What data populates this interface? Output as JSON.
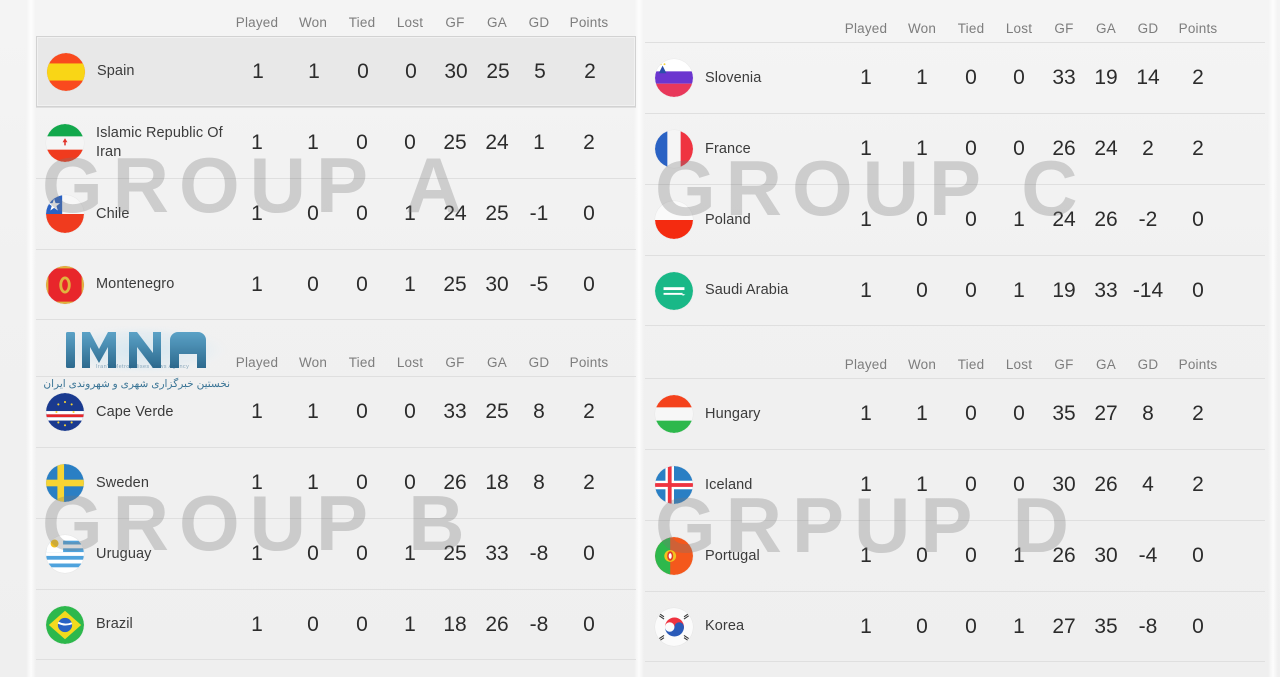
{
  "columns": [
    "Played",
    "Won",
    "Tied",
    "Lost",
    "GF",
    "GA",
    "GD",
    "Points"
  ],
  "watermarks": {
    "group_a": "GROUP A",
    "group_b": "GROUP B",
    "group_c": "GROUP C",
    "group_d": "GRPUP D"
  },
  "logo": {
    "name": "IMNA",
    "tagline_en": "Iran's Metropolises News Agency",
    "tagline_fa": "نخستین خبرگزاری شهری و شهروندی ایران"
  },
  "groups": [
    {
      "id": "group-a",
      "watermark": "GROUP A",
      "rows": [
        {
          "team": "Spain",
          "flag": "spain-flag",
          "highlight": true,
          "played": "1",
          "won": "1",
          "tied": "0",
          "lost": "0",
          "gf": "30",
          "ga": "25",
          "gd": "5",
          "points": "2"
        },
        {
          "team": "Islamic Republic Of Iran",
          "flag": "iran-flag",
          "highlight": false,
          "played": "1",
          "won": "1",
          "tied": "0",
          "lost": "0",
          "gf": "25",
          "ga": "24",
          "gd": "1",
          "points": "2"
        },
        {
          "team": "Chile",
          "flag": "chile-flag",
          "highlight": false,
          "played": "1",
          "won": "0",
          "tied": "0",
          "lost": "1",
          "gf": "24",
          "ga": "25",
          "gd": "-1",
          "points": "0"
        },
        {
          "team": "Montenegro",
          "flag": "montenegro-flag",
          "highlight": false,
          "played": "1",
          "won": "0",
          "tied": "0",
          "lost": "1",
          "gf": "25",
          "ga": "30",
          "gd": "-5",
          "points": "0"
        }
      ]
    },
    {
      "id": "group-b",
      "watermark": "GROUP B",
      "rows": [
        {
          "team": "Cape Verde",
          "flag": "capeverde-flag",
          "highlight": false,
          "played": "1",
          "won": "1",
          "tied": "0",
          "lost": "0",
          "gf": "33",
          "ga": "25",
          "gd": "8",
          "points": "2"
        },
        {
          "team": "Sweden",
          "flag": "sweden-flag",
          "highlight": false,
          "played": "1",
          "won": "1",
          "tied": "0",
          "lost": "0",
          "gf": "26",
          "ga": "18",
          "gd": "8",
          "points": "2"
        },
        {
          "team": "Uruguay",
          "flag": "uruguay-flag",
          "highlight": false,
          "played": "1",
          "won": "0",
          "tied": "0",
          "lost": "1",
          "gf": "25",
          "ga": "33",
          "gd": "-8",
          "points": "0"
        },
        {
          "team": "Brazil",
          "flag": "brazil-flag",
          "highlight": false,
          "played": "1",
          "won": "0",
          "tied": "0",
          "lost": "1",
          "gf": "18",
          "ga": "26",
          "gd": "-8",
          "points": "0"
        }
      ]
    },
    {
      "id": "group-c",
      "watermark": "GROUP C",
      "rows": [
        {
          "team": "Slovenia",
          "flag": "slovenia-flag",
          "highlight": false,
          "played": "1",
          "won": "1",
          "tied": "0",
          "lost": "0",
          "gf": "33",
          "ga": "19",
          "gd": "14",
          "points": "2"
        },
        {
          "team": "France",
          "flag": "france-flag",
          "highlight": false,
          "played": "1",
          "won": "1",
          "tied": "0",
          "lost": "0",
          "gf": "26",
          "ga": "24",
          "gd": "2",
          "points": "2"
        },
        {
          "team": "Poland",
          "flag": "poland-flag",
          "highlight": false,
          "played": "1",
          "won": "0",
          "tied": "0",
          "lost": "1",
          "gf": "24",
          "ga": "26",
          "gd": "-2",
          "points": "0"
        },
        {
          "team": "Saudi Arabia",
          "flag": "saudiarabia-flag",
          "highlight": false,
          "played": "1",
          "won": "0",
          "tied": "0",
          "lost": "1",
          "gf": "19",
          "ga": "33",
          "gd": "-14",
          "points": "0"
        }
      ]
    },
    {
      "id": "group-d",
      "watermark": "GRPUP D",
      "rows": [
        {
          "team": "Hungary",
          "flag": "hungary-flag",
          "highlight": false,
          "played": "1",
          "won": "1",
          "tied": "0",
          "lost": "0",
          "gf": "35",
          "ga": "27",
          "gd": "8",
          "points": "2"
        },
        {
          "team": "Iceland",
          "flag": "iceland-flag",
          "highlight": false,
          "played": "1",
          "won": "1",
          "tied": "0",
          "lost": "0",
          "gf": "30",
          "ga": "26",
          "gd": "4",
          "points": "2"
        },
        {
          "team": "Portugal",
          "flag": "portugal-flag",
          "highlight": false,
          "played": "1",
          "won": "0",
          "tied": "0",
          "lost": "1",
          "gf": "26",
          "ga": "30",
          "gd": "-4",
          "points": "0"
        },
        {
          "team": "Korea",
          "flag": "korea-flag",
          "highlight": false,
          "played": "1",
          "won": "0",
          "tied": "0",
          "lost": "1",
          "gf": "27",
          "ga": "35",
          "gd": "-8",
          "points": "0"
        }
      ]
    }
  ],
  "colors": {
    "background": "#f1f1f1",
    "row_border": "#dfdfdf",
    "header_text": "#7d7d7d",
    "value_text": "#2c2c2c",
    "team_text": "#3b3b3b",
    "watermark": "#787878",
    "highlight_row": "#e8e8e8",
    "logo_blue": "#2b6a8e"
  }
}
